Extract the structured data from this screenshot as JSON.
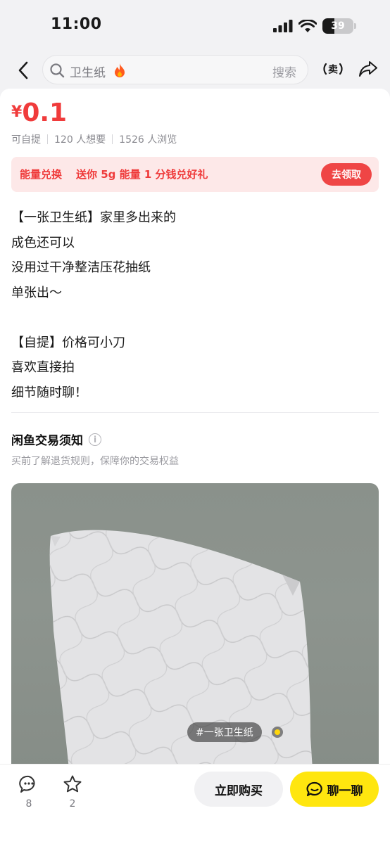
{
  "status_bar": {
    "time": "11:00",
    "battery": "39",
    "battery_level": 0.39
  },
  "nav": {
    "search_term": "卫生纸",
    "search_button": "搜索"
  },
  "listing": {
    "currency": "¥",
    "price": "0.1",
    "meta": [
      "可自提",
      "120 人想要",
      "1526 人浏览"
    ],
    "promo": {
      "title": "能量兑换",
      "desc": "送你 5g 能量 1 分钱兑好礼",
      "button": "去领取"
    },
    "description": [
      "【一张卫生纸】家里多出来的",
      "成色还可以",
      "没用过干净整洁压花抽纸",
      "单张出～",
      "",
      "【自提】价格可小刀",
      "喜欢直接拍",
      "细节随时聊！"
    ],
    "notice": {
      "title": "闲鱼交易须知",
      "subtitle": "买前了解退货规则，保障你的交易权益"
    },
    "photo_tag": "#一张卫生纸"
  },
  "bottom_bar": {
    "comments_count": "8",
    "favorites_count": "2",
    "buy_label": "立即购买",
    "chat_label": "聊一聊"
  },
  "colors": {
    "price": "#f03b3b",
    "promo_bg": "#fde8e8",
    "chat_button": "#ffe60f"
  }
}
